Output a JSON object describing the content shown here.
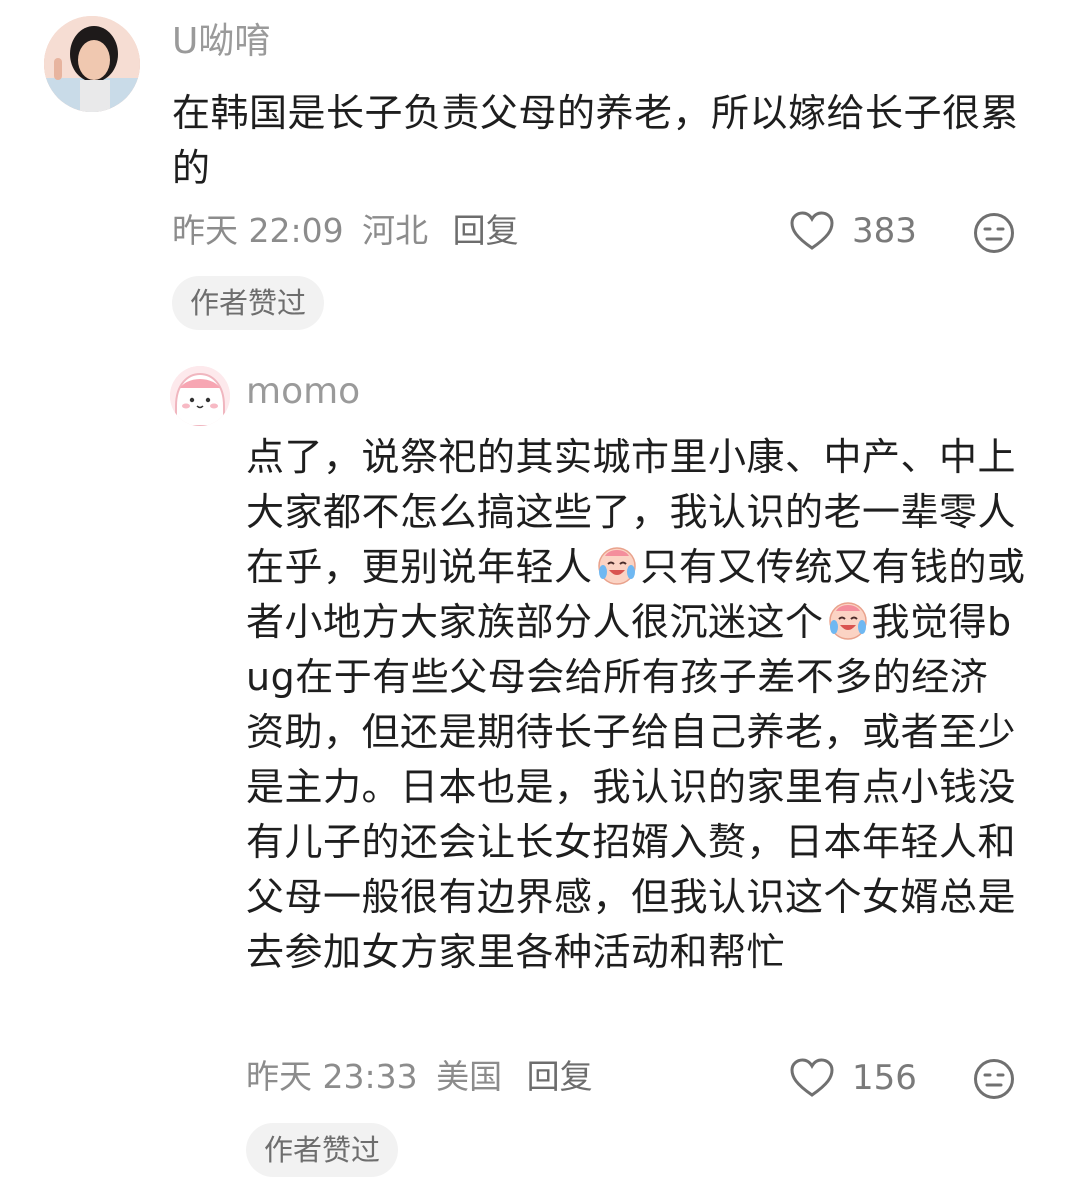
{
  "comments": [
    {
      "username": "U呦唷",
      "text": "在韩国是长子负责父母的养老，所以嫁给长子很累的",
      "time": "昨天 22:09",
      "location": "河北",
      "reply_label": "回复",
      "likes": "383",
      "badge": "作者赞过"
    },
    {
      "username": "momo",
      "text_parts": [
        "点了，说祭祀的其实城市里小康、中产、中上大家都不怎么搞这些了，我认识的老一辈零人在乎，更别说年轻人",
        "只有又传统又有钱的或者小地方大家族部分人很沉迷这个",
        "我觉得bug在于有些父母会给所有孩子差不多的经济资助，但还是期待长子给自己养老，或者至少是主力。日本也是，我认识的家里有点小钱没有儿子的还会让长女招婿入赘，日本年轻人和父母一般很有边界感，但我认识这个女婿总是去参加女方家里各种活动和帮忙"
      ],
      "time": "昨天 23:33",
      "location": "美国",
      "reply_label": "回复",
      "likes": "156",
      "badge": "作者赞过"
    }
  ],
  "icons": {
    "like": "heart-outline-icon",
    "dislike": "neutral-face-icon",
    "emoji": "crying-laughing-emoji"
  },
  "colors": {
    "meta_text": "#8c8c8c",
    "badge_bg": "#f2f2f2"
  }
}
